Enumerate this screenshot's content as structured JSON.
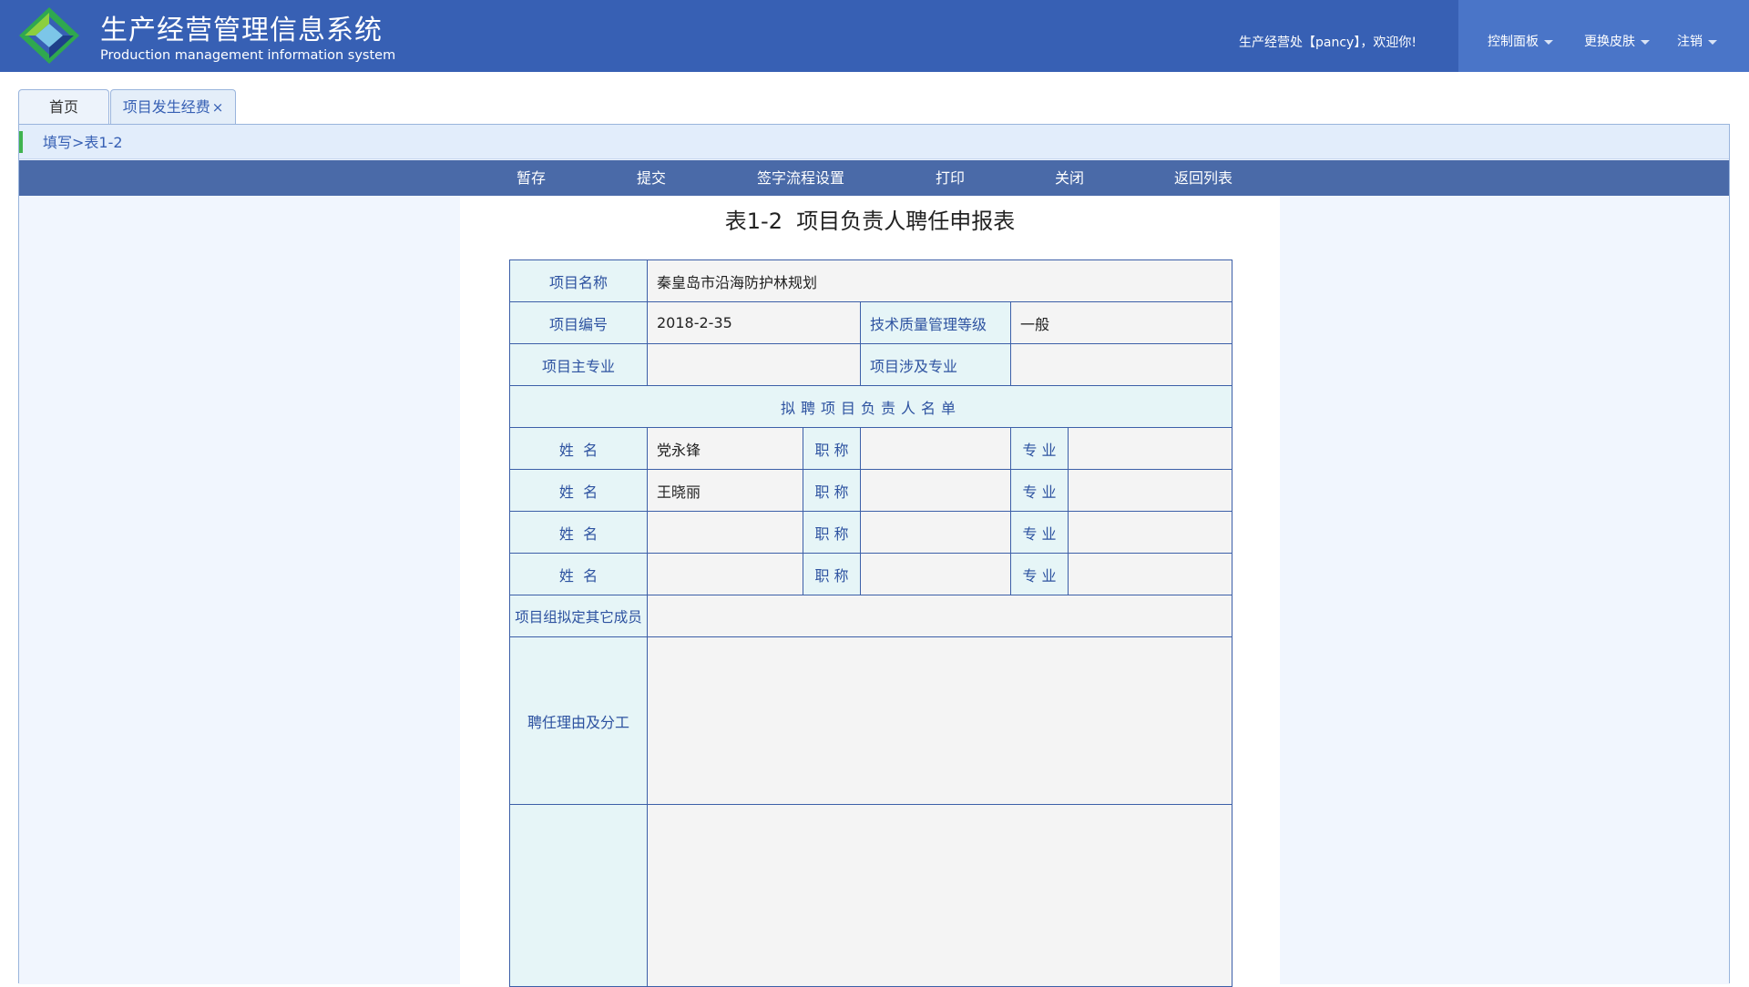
{
  "header": {
    "title": "生产经营管理信息系统",
    "subtitle": "Production management information system",
    "welcome": "生产经营处【pancy】，欢迎你!",
    "menu": [
      {
        "label": "控制面板"
      },
      {
        "label": "更换皮肤"
      },
      {
        "label": "注销"
      }
    ],
    "colors": {
      "header_bg": "#3760b4",
      "menu_bg": "#4a75c8"
    }
  },
  "tabs": {
    "home": "首页",
    "active": "项目发生经费",
    "close_glyph": "×"
  },
  "breadcrumb": "填写>表1-2",
  "toolbar": {
    "save_draft": "暂存",
    "submit": "提交",
    "sign_flow": "签字流程设置",
    "print": "打印",
    "close": "关闭",
    "back_to_list": "返回列表"
  },
  "form": {
    "title": "表1-2  项目负责人聘任申报表",
    "project_name_label": "项目名称",
    "project_name": "秦皇岛市沿海防护林规划",
    "project_no_label": "项目编号",
    "project_no": "2018-2-35",
    "quality_level_label": "技术质量管理等级",
    "quality_level": "一般",
    "main_major_label": "项目主专业",
    "main_major": "",
    "related_major_label": "项目涉及专业",
    "related_major": "",
    "section_title": "拟聘项目负责人名单",
    "candidates": [
      {
        "name_label": "姓  名",
        "name": "党永锋",
        "title_label": "职 称",
        "title": "",
        "major_label": "专 业",
        "major": ""
      },
      {
        "name_label": "姓  名",
        "name": "王晓丽",
        "title_label": "职 称",
        "title": "",
        "major_label": "专 业",
        "major": ""
      },
      {
        "name_label": "姓  名",
        "name": "",
        "title_label": "职 称",
        "title": "",
        "major_label": "专 业",
        "major": ""
      },
      {
        "name_label": "姓  名",
        "name": "",
        "title_label": "职 称",
        "title": "",
        "major_label": "专 业",
        "major": ""
      }
    ],
    "other_members_label": "项目组拟定其它成员",
    "other_members": "",
    "reason_label": "聘任理由及分工",
    "reason": "",
    "extra_label": "",
    "extra": ""
  }
}
